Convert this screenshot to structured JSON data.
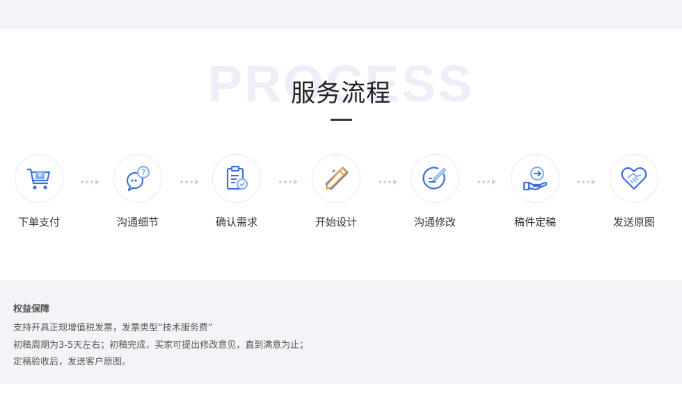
{
  "process": {
    "bg_word": "PROCESS",
    "title": "服务流程",
    "steps": [
      {
        "label": "下单支付",
        "icon": "shopping-cart-icon"
      },
      {
        "label": "沟通细节",
        "icon": "chat-question-icon"
      },
      {
        "label": "确认需求",
        "icon": "clipboard-check-icon"
      },
      {
        "label": "开始设计",
        "icon": "pencil-ruler-icon"
      },
      {
        "label": "沟通修改",
        "icon": "edit-circle-icon"
      },
      {
        "label": "稿件定稿",
        "icon": "hand-arrow-icon"
      },
      {
        "label": "发送原图",
        "icon": "handshake-heart-icon"
      }
    ]
  },
  "benefits": {
    "title": "权益保障",
    "lines": [
      "支持开具正规增值税发票，发票类型“技术服务费”",
      "初稿周期为3-5天左右；初稿完成，买家可提出修改意见，直到满意为止；",
      "定稿验收后，发送客户原图。"
    ]
  },
  "colors": {
    "accent_blue": "#3b6fe0",
    "accent_light": "#7fb0f5",
    "accent_orange": "#f0a23a",
    "band": "#f4f4f8"
  }
}
